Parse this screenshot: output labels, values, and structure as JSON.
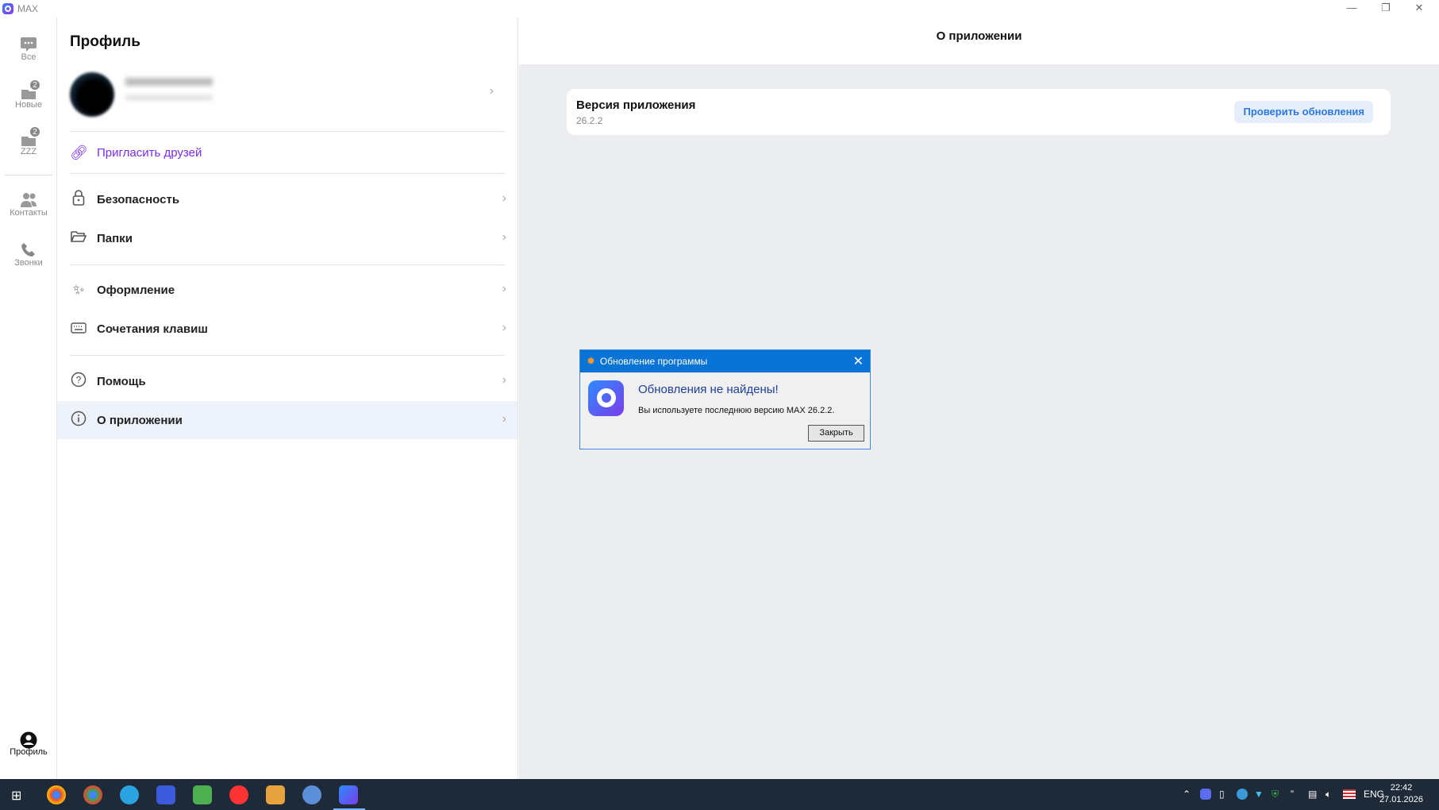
{
  "window": {
    "title": "MAX"
  },
  "rail": {
    "items": [
      {
        "label": "Все",
        "icon": "chat-icon"
      },
      {
        "label": "Новые",
        "icon": "folder-chat-icon",
        "badge": "2"
      },
      {
        "label": "ZZZ",
        "icon": "folder-chat-icon",
        "badge": "2"
      },
      {
        "label": "Контакты",
        "icon": "contacts-icon"
      },
      {
        "label": "Звонки",
        "icon": "phone-icon"
      },
      {
        "label": "Профиль",
        "icon": "profile-icon"
      }
    ]
  },
  "profile": {
    "title": "Профиль",
    "menu": [
      {
        "label": "Пригласить друзей",
        "icon": "link-icon"
      },
      {
        "label": "Безопасность",
        "icon": "lock-icon"
      },
      {
        "label": "Папки",
        "icon": "folder-icon"
      },
      {
        "label": "Оформление",
        "icon": "magic-wand-icon"
      },
      {
        "label": "Сочетания клавиш",
        "icon": "keyboard-icon"
      },
      {
        "label": "Помощь",
        "icon": "help-icon"
      },
      {
        "label": "О приложении",
        "icon": "info-icon"
      }
    ]
  },
  "about": {
    "header": "О приложении",
    "version_label": "Версия приложения",
    "version": "26.2.2",
    "check_button": "Проверить обновления"
  },
  "dialog": {
    "title": "Обновление программы",
    "heading": "Обновления не найдены!",
    "message": "Вы используете последнюю версию MAX 26.2.2.",
    "close_button": "Закрыть"
  },
  "taskbar": {
    "lang": "ENG",
    "time": "22:42",
    "date": "27.01.2026"
  },
  "colors": {
    "accent": "#2b78e4",
    "invite": "#7a2cf0",
    "dialog_titlebar": "#0a74d6",
    "taskbar": "#1f2a38"
  }
}
